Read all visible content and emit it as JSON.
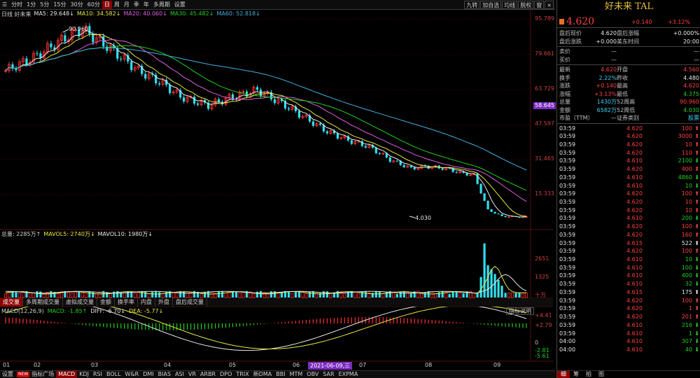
{
  "toolbar": {
    "periods": [
      "分时",
      "1分",
      "5分",
      "15分",
      "30分",
      "60分",
      "日",
      "周",
      "月",
      "季",
      "年",
      "多周期",
      "设置"
    ],
    "active_period": "日",
    "right_buttons": [
      "九转",
      "加自选",
      "均线",
      "脱权",
      "窗",
      "×"
    ]
  },
  "ma_legend": {
    "label": "日线 好未来",
    "ma5": "MA5: 29.648↓",
    "ma10": "MA10: 34.582↓",
    "ma20": "MA20: 40.060↓",
    "ma30": "MA30: 45.482↓",
    "ma60": "MA60: 52.818↓"
  },
  "price_axis": [
    "95.789",
    "79.661",
    "63.729",
    "47.597",
    "31.465",
    "15.333"
  ],
  "current_price_badge": "58.645",
  "annotations": {
    "high": "90.960",
    "low": "4.030"
  },
  "volume_legend": {
    "total": "总量: 2285万↑",
    "mavol5": "MAVOL5: 2740万↓",
    "mavol10": "MAVOL10: 1980万↓"
  },
  "volume_axis": [
    "2651",
    "1325",
    "十万"
  ],
  "tabs": [
    "成交量",
    "多周期成交量",
    "虚拟成交量",
    "金额",
    "换手率",
    "内盘",
    "外盘",
    "盘后成交量"
  ],
  "active_tab": "成交量",
  "macd_legend": {
    "name": "MACD(12,26,9)",
    "macd": "MACD: -1.85↑",
    "diff": "DIFF: -6.70↓",
    "dea": "DEA: -5.77↓"
  },
  "help_button": "指标说明",
  "macd_axis": [
    "+4.41",
    "+2.79",
    "0",
    "-2.81",
    "-5.61"
  ],
  "dates": [
    "01",
    "02",
    "03",
    "04",
    "05",
    "06",
    "2021-06-09,三",
    "07",
    "08",
    "09"
  ],
  "indicators": [
    "设置",
    "指标广场",
    "MACD",
    "KDJ",
    "RSI",
    "BOLL",
    "W&R",
    "DMI",
    "BIAS",
    "ASI",
    "VR",
    "ARBR",
    "DPO",
    "TRIX",
    "新DMA",
    "BBI",
    "MTM",
    "OBV",
    "SAR",
    "EXPMA"
  ],
  "active_indicator": "MACD",
  "new_badge": "NEW",
  "side": {
    "title": "好未来 TAL",
    "price": "4.620",
    "change": "+0.140",
    "change_pct": "+3.12%",
    "afterhours": [
      {
        "l": "盘后现价",
        "v": "4.620",
        "l2": "盘后涨幅",
        "v2": "+0.000%"
      },
      {
        "l": "盘后涨跌",
        "v": "+0.000",
        "l2": "美东时间",
        "v2": "20:00"
      }
    ],
    "bidask": [
      {
        "l": "卖价",
        "v": "—",
        "v2": "—"
      },
      {
        "l": "买价",
        "v": "—",
        "v2": "—"
      }
    ],
    "stats": [
      {
        "l": "最新",
        "v": "4.620",
        "l2": "开盘",
        "v2": "4.560",
        "c1": "t-red",
        "c2": "t-red"
      },
      {
        "l": "换手",
        "v": "2.22%",
        "l2": "昨收",
        "v2": "4.480",
        "c1": "t-cyan",
        "c2": "t-white"
      },
      {
        "l": "涨跌",
        "v": "+0.140",
        "l2": "最高",
        "v2": "4.620",
        "c1": "t-red",
        "c2": "t-red"
      },
      {
        "l": "涨幅",
        "v": "+3.13%",
        "l2": "最低",
        "v2": "4.375",
        "c1": "t-red",
        "c2": "t-green"
      },
      {
        "l": "总量",
        "v": "1430万",
        "l2": "52周高",
        "v2": "90.960",
        "c1": "t-cyan",
        "c2": "t-red"
      },
      {
        "l": "金额",
        "v": "6582万",
        "l2": "52周低",
        "v2": "4.030",
        "c1": "t-cyan",
        "c2": "t-green"
      },
      {
        "l": "市盈（TTM）",
        "v": "—",
        "l2": "证券类别",
        "v2": "股票",
        "c1": "t-gray",
        "c2": "t-cyan"
      }
    ],
    "ticks": [
      [
        "03:59",
        "4.620",
        "100",
        "up"
      ],
      [
        "03:59",
        "4.620",
        "3000",
        "up"
      ],
      [
        "03:59",
        "4.620",
        "10",
        "up"
      ],
      [
        "03:59",
        "4.620",
        "110",
        "up"
      ],
      [
        "03:59",
        "4.610",
        "2100",
        "dn"
      ],
      [
        "03:59",
        "4.620",
        "400",
        "up"
      ],
      [
        "03:59",
        "4.610",
        "4860",
        "dn"
      ],
      [
        "03:59",
        "4.610",
        "10",
        "dn"
      ],
      [
        "03:59",
        "4.620",
        "100",
        "up"
      ],
      [
        "03:59",
        "4.620",
        "10",
        "up"
      ],
      [
        "03:59",
        "4.620",
        "10",
        "up"
      ],
      [
        "03:59",
        "4.610",
        "200",
        "dn"
      ],
      [
        "03:59",
        "4.620",
        "100",
        "up"
      ],
      [
        "03:59",
        "4.620",
        "160",
        "up"
      ],
      [
        "03:59",
        "4.615",
        "522",
        "wh"
      ],
      [
        "03:59",
        "4.620",
        "100",
        "up"
      ],
      [
        "03:59",
        "4.610",
        "10",
        "dn"
      ],
      [
        "03:59",
        "4.610",
        "100",
        "dn"
      ],
      [
        "03:59",
        "4.610",
        "400",
        "dn"
      ],
      [
        "03:59",
        "4.610",
        "32",
        "dn"
      ],
      [
        "03:59",
        "4.615",
        "175",
        "wh"
      ],
      [
        "03:59",
        "4.620",
        "100",
        "up"
      ],
      [
        "03:59",
        "4.620",
        "1",
        "up"
      ],
      [
        "03:59",
        "4.620",
        "201",
        "up"
      ],
      [
        "03:59",
        "4.610",
        "216",
        "dn"
      ],
      [
        "03:59",
        "4.610",
        "1",
        "dn"
      ],
      [
        "04:00",
        "4.610",
        "307",
        "dn"
      ],
      [
        "04:00",
        "4.610",
        "40",
        "dn"
      ]
    ],
    "bottom_tabs": [
      "细",
      "筹",
      "拍",
      "图"
    ]
  },
  "colors": {
    "up": "#ff3030",
    "down": "#30e0f0",
    "ma5": "#e8e8e8",
    "ma10": "#e8e840",
    "ma20": "#e060e0",
    "ma30": "#20d020",
    "ma60": "#40b0e0"
  }
}
